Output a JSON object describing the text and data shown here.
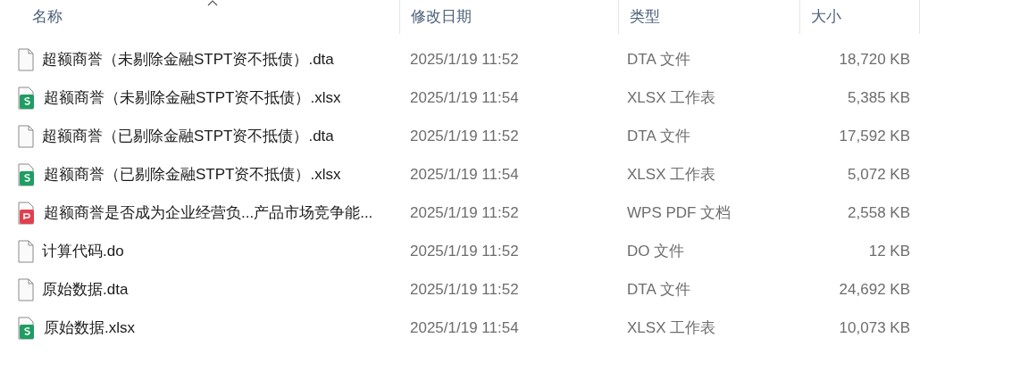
{
  "columns": [
    {
      "label": "名称",
      "sorted": true
    },
    {
      "label": "修改日期",
      "sorted": false
    },
    {
      "label": "类型",
      "sorted": false
    },
    {
      "label": "大小",
      "sorted": false
    }
  ],
  "files": [
    {
      "kind": "generic",
      "name": "超额商誉（未剔除金融STPT资不抵债）.dta",
      "modified": "2025/1/19 11:52",
      "type": "DTA 文件",
      "size": "18,720 KB"
    },
    {
      "kind": "sheet",
      "name": "超额商誉（未剔除金融STPT资不抵债）.xlsx",
      "modified": "2025/1/19 11:54",
      "type": "XLSX 工作表",
      "size": "5,385 KB"
    },
    {
      "kind": "generic",
      "name": "超额商誉（已剔除金融STPT资不抵债）.dta",
      "modified": "2025/1/19 11:52",
      "type": "DTA 文件",
      "size": "17,592 KB"
    },
    {
      "kind": "sheet",
      "name": "超额商誉（已剔除金融STPT资不抵债）.xlsx",
      "modified": "2025/1/19 11:54",
      "type": "XLSX 工作表",
      "size": "5,072 KB"
    },
    {
      "kind": "pdf",
      "name": "超额商誉是否成为企业经营负...产品市场竞争能...",
      "modified": "2025/1/19 11:52",
      "type": "WPS PDF 文档",
      "size": "2,558 KB"
    },
    {
      "kind": "generic",
      "name": "计算代码.do",
      "modified": "2025/1/19 11:52",
      "type": "DO 文件",
      "size": "12 KB"
    },
    {
      "kind": "generic",
      "name": "原始数据.dta",
      "modified": "2025/1/19 11:52",
      "type": "DTA 文件",
      "size": "24,692 KB"
    },
    {
      "kind": "sheet",
      "name": "原始数据.xlsx",
      "modified": "2025/1/19 11:54",
      "type": "XLSX 工作表",
      "size": "10,073 KB"
    }
  ]
}
